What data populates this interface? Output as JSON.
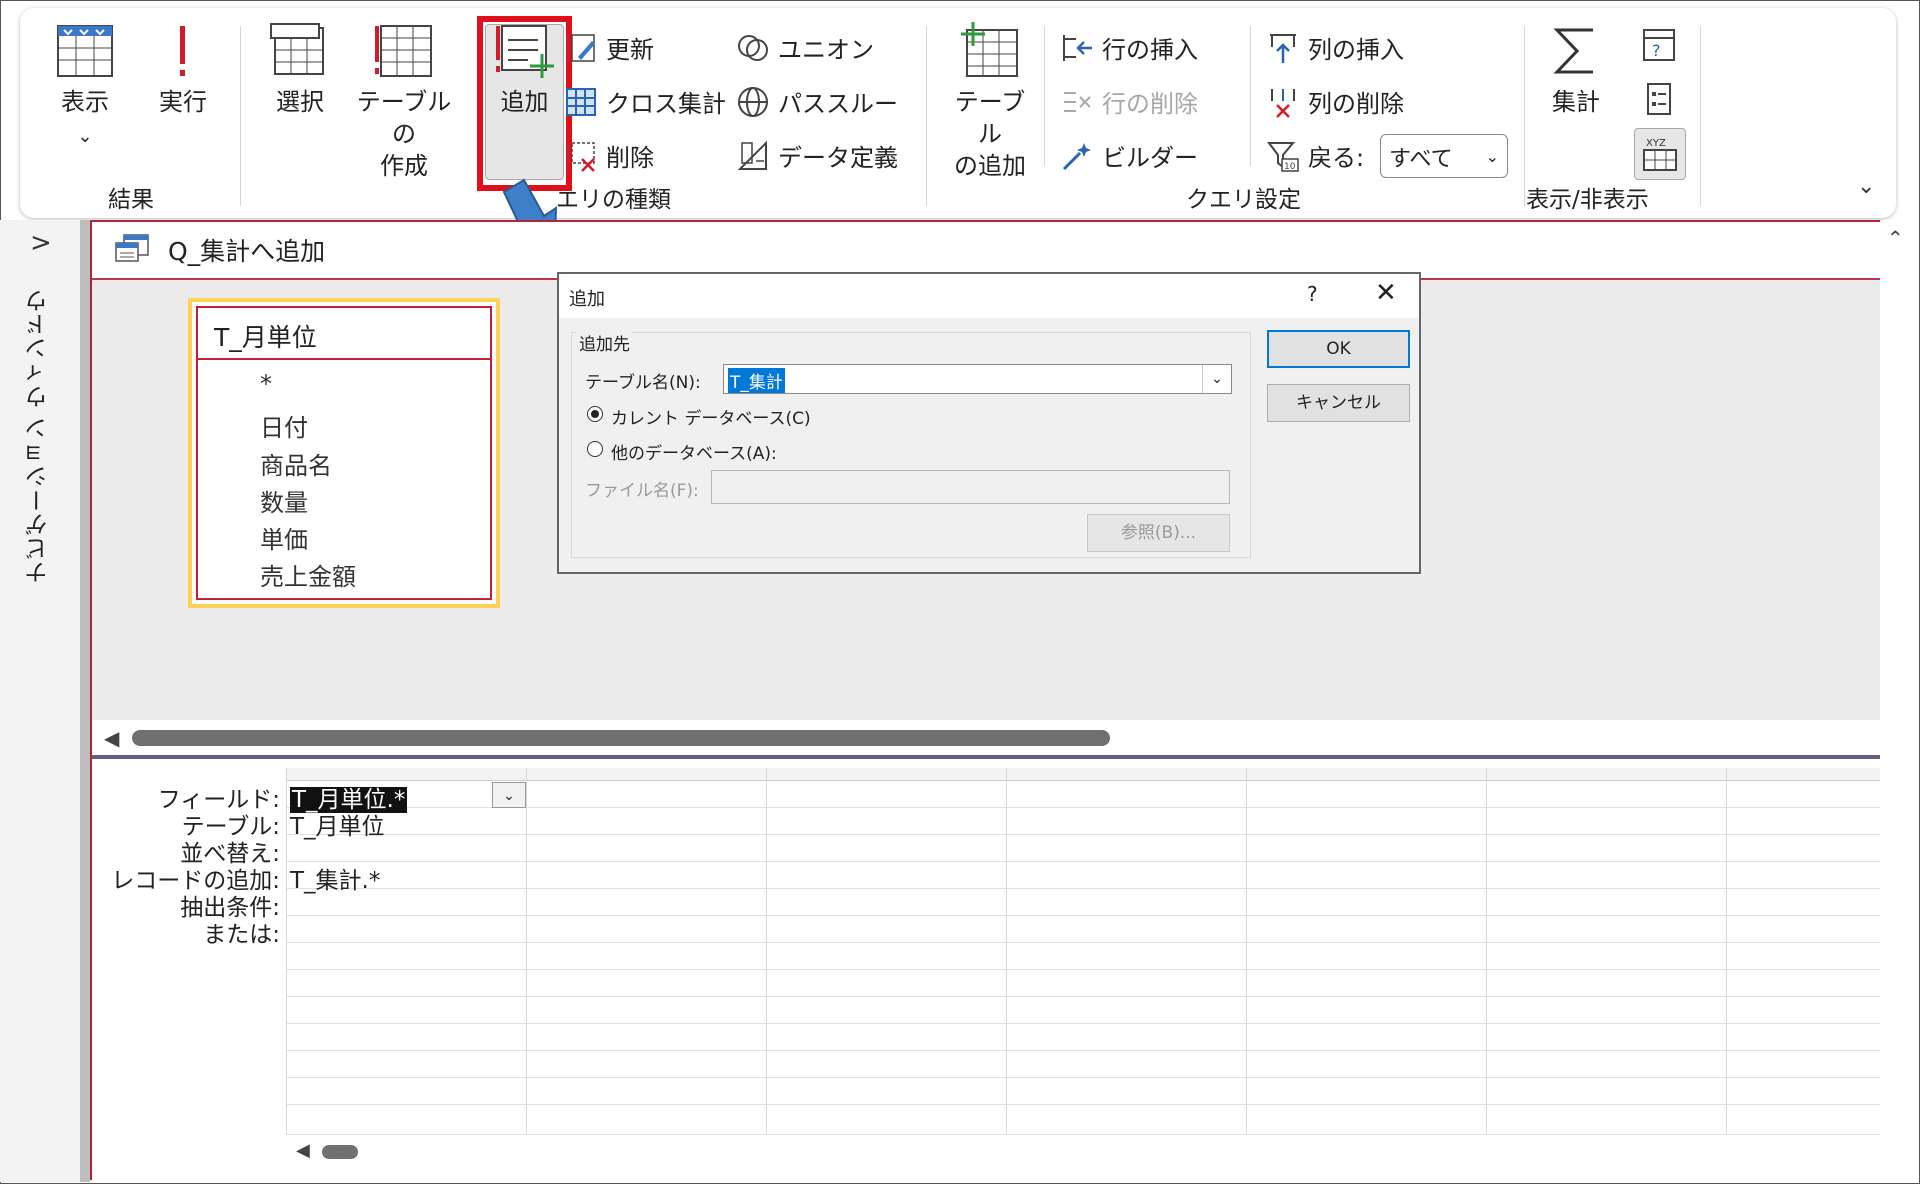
{
  "ribbon": {
    "groups": {
      "results": "結果",
      "query_type": "エリの種類",
      "query_setup": "クエリ設定",
      "show_hide": "表示/非表示"
    },
    "view": "表示",
    "view_chevron": "⌄",
    "run": "実行",
    "select": "選択",
    "make_table_l1": "テーブルの",
    "make_table_l2": "作成",
    "append": "追加",
    "update": "更新",
    "crosstab": "クロス集計",
    "delete": "削除",
    "union": "ユニオン",
    "passthrough": "パススルー",
    "data_definition": "データ定義",
    "add_table_l1": "テーブル",
    "add_table_l2": "の追加",
    "insert_rows": "行の挿入",
    "delete_rows": "行の削除",
    "builder": "ビルダー",
    "insert_columns": "列の挿入",
    "delete_columns": "列の削除",
    "return_label": "戻る:",
    "return_value": "すべて",
    "totals": "集計",
    "accent_red": "#e0101a"
  },
  "nav": {
    "label": "ナビゲーション ウィンドウ",
    "toggle": ">"
  },
  "document": {
    "tab_title": "Q_集計へ追加"
  },
  "table_box": {
    "title": "T_月単位",
    "fields": [
      "*",
      "日付",
      "商品名",
      "数量",
      "単価",
      "売上金額"
    ]
  },
  "dialog": {
    "title": "追加",
    "help": "?",
    "close": "✕",
    "group_label": "追加先",
    "table_name_label": "テーブル名(N):",
    "table_name_value": "T_集計",
    "current_db": "カレント データベース(C)",
    "other_db": "他のデータベース(A):",
    "file_name_label": "ファイル名(F):",
    "ok": "OK",
    "cancel": "キャンセル",
    "browse": "参照(B)..."
  },
  "grid": {
    "row_labels": [
      "フィールド:",
      "テーブル:",
      "並べ替え:",
      "レコードの追加:",
      "抽出条件:",
      "または:"
    ],
    "column1": {
      "field": "T_月単位.*",
      "table": "T_月単位",
      "sort": "",
      "append_to": "T_集計.*",
      "criteria": "",
      "or": ""
    }
  }
}
